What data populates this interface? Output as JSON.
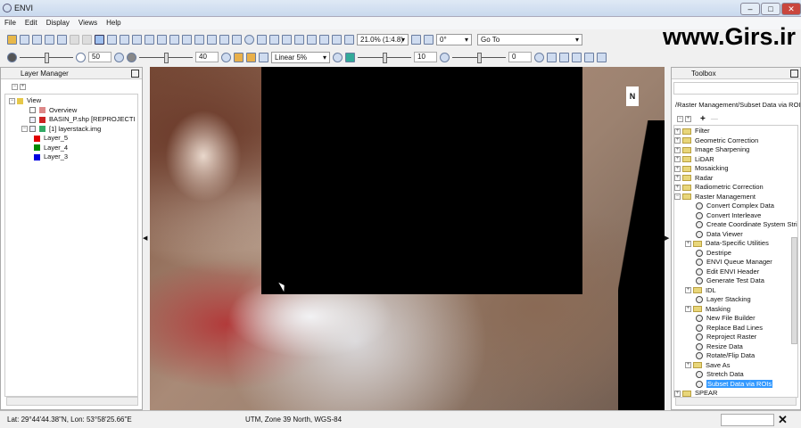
{
  "window": {
    "title": "ENVI"
  },
  "menu": [
    "File",
    "Edit",
    "Display",
    "Views",
    "Help"
  ],
  "toolbar": {
    "zoom": "21.0% (1:4.8)",
    "rotation": "0°",
    "goto": "Go To"
  },
  "toolbar2": {
    "brightness": "50",
    "contrast": "40",
    "stretch": "Linear 5%",
    "sharpen": "10",
    "transparency": "0"
  },
  "watermark": "www.Girs.ir",
  "layer_manager": {
    "title": "Layer Manager",
    "items": [
      {
        "label": "View",
        "level": 0
      },
      {
        "label": "Overview",
        "level": 1
      },
      {
        "label": "BASIN_P.shp [REPROJECTI",
        "level": 1
      },
      {
        "label": "[1] layerstack.img",
        "level": 1
      },
      {
        "label": "Layer_5",
        "level": 2,
        "color": "#e00000"
      },
      {
        "label": "Layer_4",
        "level": 2,
        "color": "#008a00"
      },
      {
        "label": "Layer_3",
        "level": 2,
        "color": "#0000e0"
      }
    ]
  },
  "toolbox": {
    "title": "Toolbox",
    "path": "/Raster Management/Subset Data via ROIs",
    "items": [
      {
        "label": "Filter",
        "type": "folder"
      },
      {
        "label": "Geometric Correction",
        "type": "folder"
      },
      {
        "label": "Image Sharpening",
        "type": "folder"
      },
      {
        "label": "LiDAR",
        "type": "folder"
      },
      {
        "label": "Mosaicking",
        "type": "folder"
      },
      {
        "label": "Radar",
        "type": "folder"
      },
      {
        "label": "Radiometric Correction",
        "type": "folder"
      },
      {
        "label": "Raster Management",
        "type": "folder"
      },
      {
        "label": "Convert Complex Data",
        "type": "tool"
      },
      {
        "label": "Convert Interleave",
        "type": "tool"
      },
      {
        "label": "Create Coordinate System Stri",
        "type": "tool"
      },
      {
        "label": "Data Viewer",
        "type": "tool"
      },
      {
        "label": "Data-Specific Utilities",
        "type": "subfolder"
      },
      {
        "label": "Destripe",
        "type": "tool"
      },
      {
        "label": "ENVI Queue Manager",
        "type": "tool"
      },
      {
        "label": "Edit ENVI Header",
        "type": "tool"
      },
      {
        "label": "Generate Test Data",
        "type": "tool"
      },
      {
        "label": "IDL",
        "type": "subfolder"
      },
      {
        "label": "Layer Stacking",
        "type": "tool"
      },
      {
        "label": "Masking",
        "type": "subfolder"
      },
      {
        "label": "New File Builder",
        "type": "tool"
      },
      {
        "label": "Replace Bad Lines",
        "type": "tool"
      },
      {
        "label": "Reproject Raster",
        "type": "tool"
      },
      {
        "label": "Resize Data",
        "type": "tool"
      },
      {
        "label": "Rotate/Flip Data",
        "type": "tool"
      },
      {
        "label": "Save As",
        "type": "subfolder"
      },
      {
        "label": "Stretch Data",
        "type": "tool"
      },
      {
        "label": "Subset Data via ROIs",
        "type": "tool",
        "selected": true
      },
      {
        "label": "SPEAR",
        "type": "folder"
      }
    ]
  },
  "status": {
    "coords": "Lat: 29°44'44.38\"N, Lon: 53°58'25.66\"E",
    "projection": "UTM, Zone 39 North, WGS-84"
  },
  "north_arrow": "N"
}
